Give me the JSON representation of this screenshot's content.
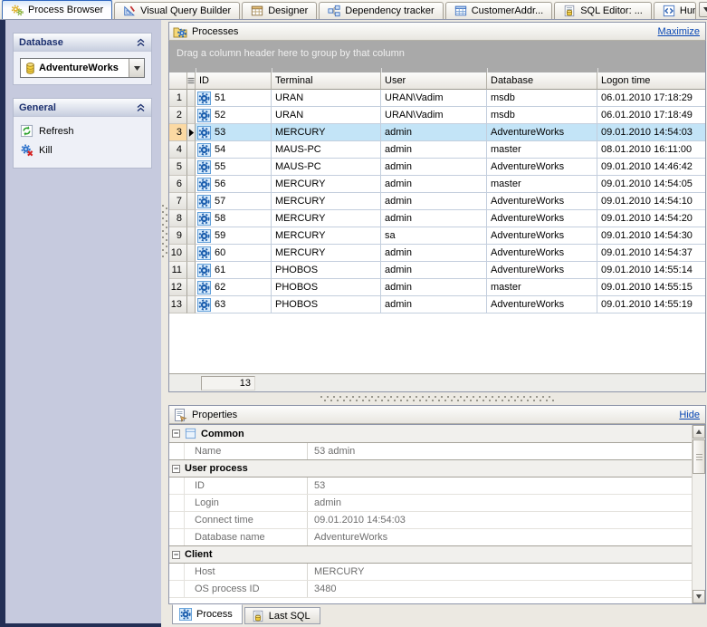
{
  "colors": {
    "accent_blue": "#2f66c0",
    "link_color": "#0645b4",
    "selection_row": "#c3e4f7",
    "selection_rownum": "#fbd9a3",
    "window_border_navy": "#232f55",
    "group_by_bar": "#a9a9a9"
  },
  "tabbar": {
    "tabs": [
      {
        "label": "Process Browser",
        "icon": "process-browser-icon",
        "active": true,
        "truncated": false
      },
      {
        "label": "Visual Query Builder",
        "icon": "query-builder-icon",
        "active": false,
        "truncated": false
      },
      {
        "label": "Designer",
        "icon": "designer-icon",
        "active": false,
        "truncated": false
      },
      {
        "label": "Dependency tracker",
        "icon": "dependency-tracker-icon",
        "active": false,
        "truncated": false
      },
      {
        "label": "CustomerAddr...",
        "icon": "table-icon",
        "active": false,
        "truncated": false
      },
      {
        "label": "SQL Editor: ...",
        "icon": "sql-editor-icon",
        "active": false,
        "truncated": false
      },
      {
        "label": "Hun",
        "icon": "code-icon",
        "active": false,
        "truncated": true
      }
    ],
    "buttons": [
      {
        "name": "tab-list-dropdown-button",
        "icon": "dropdown-arrow-icon"
      },
      {
        "name": "scroll-tabs-left-button",
        "icon": "arrow-left-icon"
      },
      {
        "name": "scroll-tabs-right-button",
        "icon": "arrow-right-icon"
      },
      {
        "name": "close-tab-button",
        "icon": "close-icon"
      }
    ]
  },
  "sidebar": {
    "sections": [
      {
        "title": "Database"
      },
      {
        "title": "General"
      }
    ],
    "database_combo": {
      "value": "AdventureWorks",
      "icon": "database-icon"
    },
    "actions": [
      {
        "label": "Refresh",
        "icon": "refresh-icon"
      },
      {
        "label": "Kill",
        "icon": "kill-icon"
      }
    ]
  },
  "processes": {
    "title": "Processes",
    "maximize_link": "Maximize",
    "group_by_hint": "Drag a column header here to group by that column",
    "columns": [
      "ID",
      "Terminal",
      "User",
      "Database",
      "Logon time"
    ],
    "rows": [
      {
        "num": 1,
        "id": 51,
        "terminal": "URAN",
        "user": "URAN\\Vadim",
        "database": "msdb",
        "logon": "06.01.2010 17:18:29",
        "selected": false
      },
      {
        "num": 2,
        "id": 52,
        "terminal": "URAN",
        "user": "URAN\\Vadim",
        "database": "msdb",
        "logon": "06.01.2010 17:18:49",
        "selected": false
      },
      {
        "num": 3,
        "id": 53,
        "terminal": "MERCURY",
        "user": "admin",
        "database": "AdventureWorks",
        "logon": "09.01.2010 14:54:03",
        "selected": true
      },
      {
        "num": 4,
        "id": 54,
        "terminal": "MAUS-PC",
        "user": "admin",
        "database": "master",
        "logon": "08.01.2010 16:11:00",
        "selected": false
      },
      {
        "num": 5,
        "id": 55,
        "terminal": "MAUS-PC",
        "user": "admin",
        "database": "AdventureWorks",
        "logon": "09.01.2010 14:46:42",
        "selected": false
      },
      {
        "num": 6,
        "id": 56,
        "terminal": "MERCURY",
        "user": "admin",
        "database": "master",
        "logon": "09.01.2010 14:54:05",
        "selected": false
      },
      {
        "num": 7,
        "id": 57,
        "terminal": "MERCURY",
        "user": "admin",
        "database": "AdventureWorks",
        "logon": "09.01.2010 14:54:10",
        "selected": false
      },
      {
        "num": 8,
        "id": 58,
        "terminal": "MERCURY",
        "user": "admin",
        "database": "AdventureWorks",
        "logon": "09.01.2010 14:54:20",
        "selected": false
      },
      {
        "num": 9,
        "id": 59,
        "terminal": "MERCURY",
        "user": "sa",
        "database": "AdventureWorks",
        "logon": "09.01.2010 14:54:30",
        "selected": false
      },
      {
        "num": 10,
        "id": 60,
        "terminal": "MERCURY",
        "user": "admin",
        "database": "AdventureWorks",
        "logon": "09.01.2010 14:54:37",
        "selected": false
      },
      {
        "num": 11,
        "id": 61,
        "terminal": "PHOBOS",
        "user": "admin",
        "database": "AdventureWorks",
        "logon": "09.01.2010 14:55:14",
        "selected": false
      },
      {
        "num": 12,
        "id": 62,
        "terminal": "PHOBOS",
        "user": "admin",
        "database": "master",
        "logon": "09.01.2010 14:55:15",
        "selected": false
      },
      {
        "num": 13,
        "id": 63,
        "terminal": "PHOBOS",
        "user": "admin",
        "database": "AdventureWorks",
        "logon": "09.01.2010 14:55:19",
        "selected": false
      }
    ],
    "row_count": "13"
  },
  "properties": {
    "title": "Properties",
    "hide_link": "Hide",
    "groups": [
      {
        "name": "Common",
        "icon": "window-icon",
        "rows": [
          {
            "name": "Name",
            "value": "53 admin"
          }
        ]
      },
      {
        "name": "User process",
        "icon": null,
        "rows": [
          {
            "name": "ID",
            "value": "53"
          },
          {
            "name": "Login",
            "value": "admin"
          },
          {
            "name": "Connect time",
            "value": "09.01.2010 14:54:03"
          },
          {
            "name": "Database name",
            "value": "AdventureWorks"
          }
        ]
      },
      {
        "name": "Client",
        "icon": null,
        "rows": [
          {
            "name": "Host",
            "value": "MERCURY"
          },
          {
            "name": "OS process ID",
            "value": "3480"
          }
        ]
      }
    ],
    "tabs": [
      {
        "label": "Process",
        "icon": "process-gear-icon",
        "active": true
      },
      {
        "label": "Last SQL",
        "icon": "sql-doc-icon",
        "active": false
      }
    ]
  }
}
